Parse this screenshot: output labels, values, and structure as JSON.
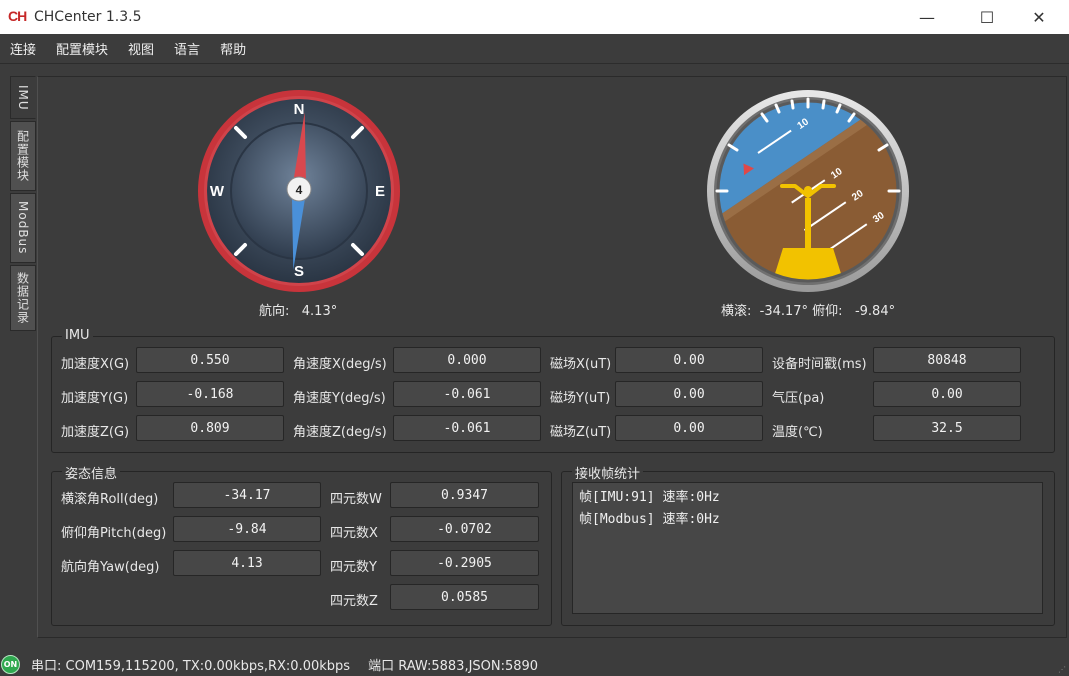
{
  "window": {
    "icon_text": "CH",
    "title": "CHCenter 1.3.5",
    "minimize": "—",
    "maximize": "☐",
    "close": "✕"
  },
  "menu": [
    "连接",
    "配置模块",
    "视图",
    "语言",
    "帮助"
  ],
  "side_tabs": [
    "IMU",
    "配置模块",
    "ModBus",
    "数据记录"
  ],
  "compass": {
    "heading_deg": 4.13,
    "center_label": "4",
    "directions": {
      "n": "N",
      "s": "S",
      "e": "E",
      "w": "W"
    },
    "caption": "航向:   4.13°",
    "colors": {
      "ring": "#c8343b",
      "face": "#3b4a5e",
      "needle_north": "#d9484e",
      "needle_south": "#4a90d9"
    }
  },
  "attitude": {
    "roll_deg": -34.17,
    "pitch_deg": -9.84,
    "pitch_ticks": [
      "10",
      "20",
      "30"
    ],
    "caption": "横滚:  -34.17° 俯仰:   -9.84°",
    "colors": {
      "sky": "#4a8fc8",
      "ground": "#8a5c34",
      "aircraft": "#f2c200"
    }
  },
  "imu": {
    "title": "IMU",
    "col1": [
      {
        "label": "加速度X(G)",
        "value": "0.550"
      },
      {
        "label": "加速度Y(G)",
        "value": "-0.168"
      },
      {
        "label": "加速度Z(G)",
        "value": "0.809"
      }
    ],
    "col2": [
      {
        "label": "角速度X(deg/s)",
        "value": "0.000"
      },
      {
        "label": "角速度Y(deg/s)",
        "value": "-0.061"
      },
      {
        "label": "角速度Z(deg/s)",
        "value": "-0.061"
      }
    ],
    "col3": [
      {
        "label": "磁场X(uT)",
        "value": "0.00"
      },
      {
        "label": "磁场Y(uT)",
        "value": "0.00"
      },
      {
        "label": "磁场Z(uT)",
        "value": "0.00"
      }
    ],
    "col4": [
      {
        "label": "设备时间戳(ms)",
        "value": "80848"
      },
      {
        "label": "气压(pa)",
        "value": "0.00"
      },
      {
        "label": "温度(℃)",
        "value": "32.5"
      }
    ]
  },
  "attitude_info": {
    "title": "姿态信息",
    "euler": [
      {
        "label": "横滚角Roll(deg)",
        "value": "-34.17"
      },
      {
        "label": "俯仰角Pitch(deg)",
        "value": "-9.84"
      },
      {
        "label": "航向角Yaw(deg)",
        "value": "4.13"
      }
    ],
    "quat": [
      {
        "label": "四元数W",
        "value": "0.9347"
      },
      {
        "label": "四元数X",
        "value": "-0.0702"
      },
      {
        "label": "四元数Y",
        "value": "-0.2905"
      },
      {
        "label": "四元数Z",
        "value": "0.0585"
      }
    ]
  },
  "frame_stats": {
    "title": "接收帧统计",
    "lines": [
      "帧[IMU:91] 速率:0Hz",
      "帧[Modbus] 速率:0Hz"
    ]
  },
  "status": {
    "led": "ON",
    "serial": "串口: COM159,115200, TX:0.00kbps,RX:0.00kbps",
    "port": "端口 RAW:5883,JSON:5890",
    "grip": "⋰"
  }
}
